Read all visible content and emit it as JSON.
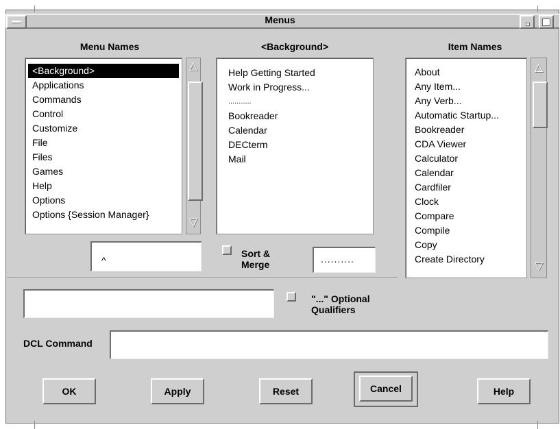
{
  "window": {
    "title": "Menus"
  },
  "menu_names": {
    "header": "Menu Names",
    "items": [
      "<Background>",
      "Applications",
      "Commands",
      "Control",
      "Customize",
      "File",
      "Files",
      "Games",
      "Help",
      "Options",
      "Options {Session Manager}"
    ],
    "selected_index": 0,
    "input_value": "^"
  },
  "background_list": {
    "header": "<Background>",
    "items": [
      "Help Getting Started",
      "Work in Progress...",
      "...........",
      "Bookreader",
      "Calendar",
      "DECterm",
      "Mail"
    ]
  },
  "item_names": {
    "header": "Item Names",
    "items": [
      "About",
      "Any Item...",
      "Any Verb...",
      "Automatic Startup...",
      "Bookreader",
      "CDA Viewer",
      "Calculator",
      "Calendar",
      "Cardfiler",
      "Clock",
      "Compare",
      "Compile",
      "Copy",
      "Create Directory"
    ]
  },
  "sort_merge": {
    "label_line1": "Sort &",
    "label_line2": "Merge",
    "separator_value": "..........",
    "checked": false
  },
  "qualifier_input": {
    "value": ""
  },
  "optional_qualifiers": {
    "label_line1": "\"...\" Optional",
    "label_line2": "Qualifiers",
    "checked": false
  },
  "dcl": {
    "label": "DCL Command",
    "value": ""
  },
  "buttons": {
    "ok": "OK",
    "apply": "Apply",
    "reset": "Reset",
    "cancel": "Cancel",
    "help": "Help"
  }
}
